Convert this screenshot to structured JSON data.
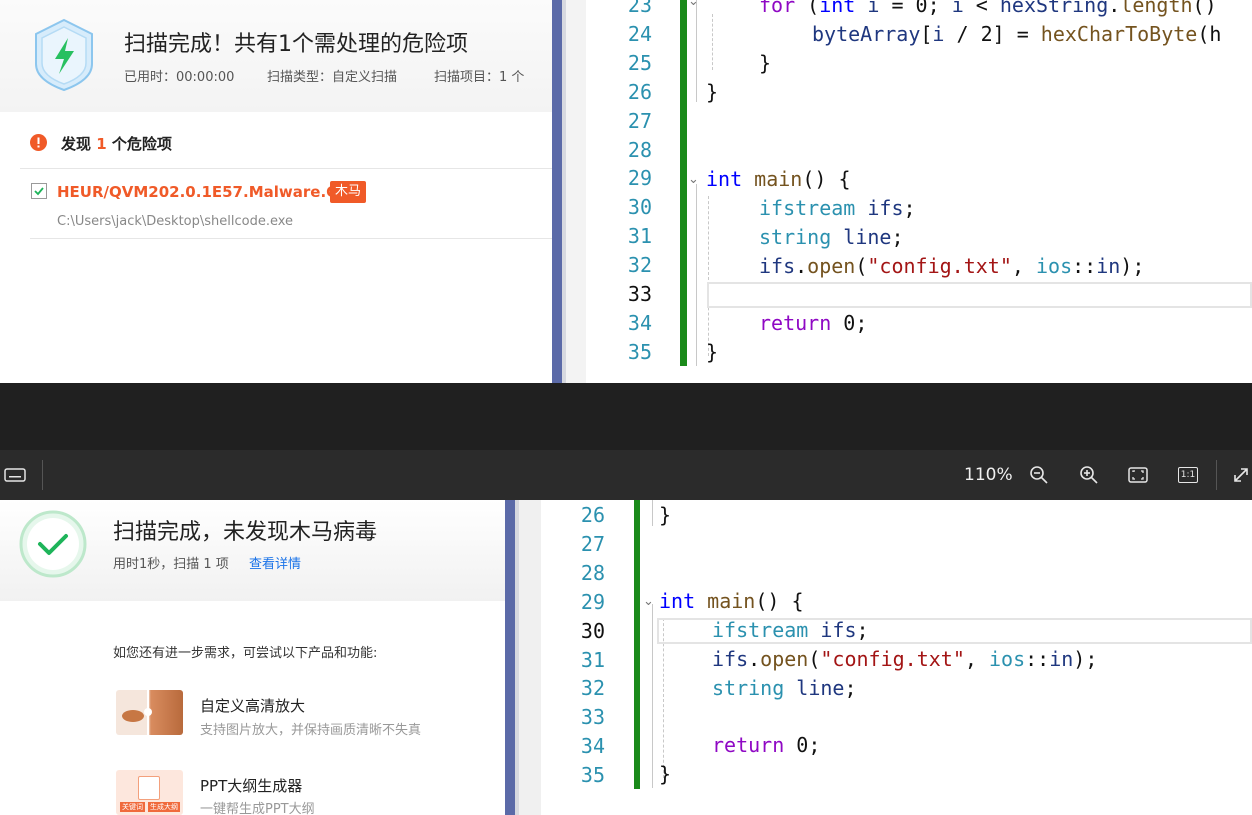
{
  "top_scan": {
    "title": "扫描完成！共有1个需处理的危险项",
    "meta_time": "已用时：00:00:00",
    "meta_type": "扫描类型：自定义扫描",
    "meta_items": "扫描项目：1 个",
    "found_prefix": "发现",
    "found_count": "1",
    "found_suffix": "个危险项",
    "threat_name": "HEUR/QVM202.0.1E57.Malware.Gen",
    "threat_tag": "木马",
    "threat_path": "C:\\Users\\jack\\Desktop\\shellcode.exe"
  },
  "top_code": {
    "line_numbers": [
      "23",
      "24",
      "25",
      "26",
      "27",
      "28",
      "29",
      "30",
      "31",
      "32",
      "33",
      "34",
      "35"
    ],
    "current_line": "33"
  },
  "toolbar": {
    "zoom": "110%",
    "actual_size": "1:1"
  },
  "bottom_scan": {
    "title": "扫描完成，未发现木马病毒",
    "meta": "用时1秒，扫描 1 项",
    "details_link": "查看详情",
    "suggest_text": "如您还有进一步需求，可尝试以下产品和功能:",
    "product1_name": "自定义高清放大",
    "product1_desc": "支持图片放大，并保持画质清晰不失真",
    "product2_name": "PPT大纲生成器",
    "product2_desc": "一键帮生成PPT大纲",
    "thumb2_tag1": "关键词",
    "thumb2_tag2": "生成大纲"
  },
  "bottom_code": {
    "line_numbers": [
      "26",
      "27",
      "28",
      "29",
      "30",
      "31",
      "32",
      "33",
      "34",
      "35"
    ],
    "current_line": "30"
  },
  "colors": {
    "danger": "#f05a28",
    "safe": "#1eb45a",
    "link": "#1a73e8",
    "keyword": "#0000ff",
    "control_keyword": "#8f08c4",
    "string": "#a31515",
    "type": "#2b91af",
    "change_bar": "#1a8a1a"
  }
}
